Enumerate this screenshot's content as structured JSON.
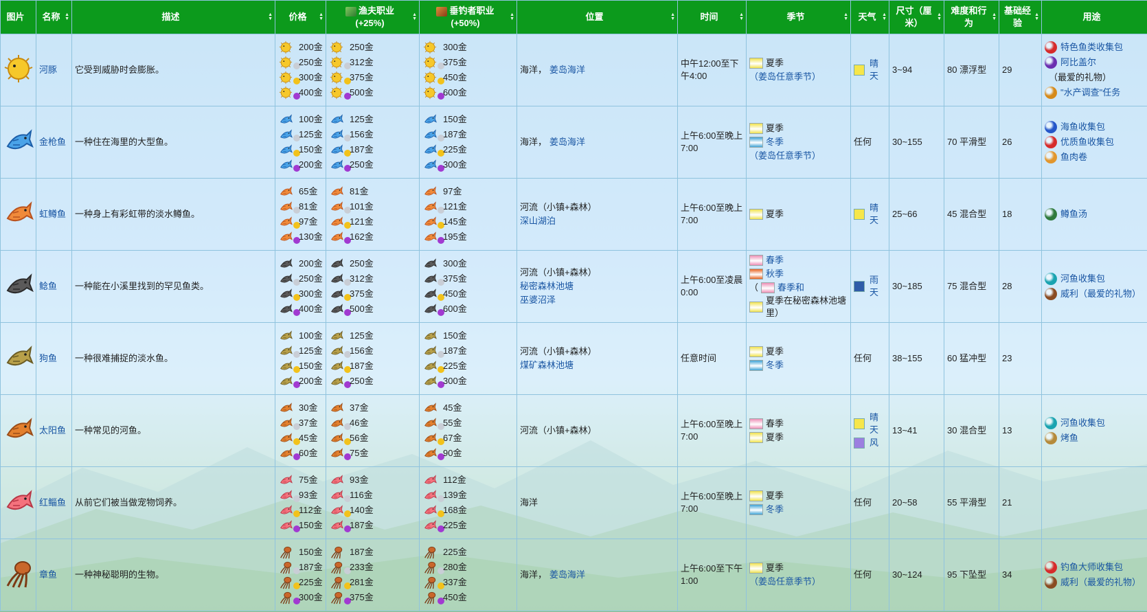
{
  "headers": {
    "image": "图片",
    "name": "名称",
    "desc": "描述",
    "price": "价格",
    "fisher": "渔夫职业",
    "fisher_pct": "(+25%)",
    "angler": "垂钓者职业",
    "angler_pct": "(+50%)",
    "location": "位置",
    "time": "时间",
    "season": "季节",
    "weather": "天气",
    "size": "尺寸（厘米）",
    "difficulty": "难度和行为",
    "xp": "基础经验",
    "uses": "用途"
  },
  "colors": {
    "header_bg": "#0c9a1c",
    "link": "#1a56a3",
    "border": "#8fc3de"
  },
  "rows": [
    {
      "name": "河豚",
      "icon": "pufferfish-icon",
      "desc": "它受到威胁时会膨胀。",
      "price": [
        "200金",
        "250金",
        "300金",
        "400金"
      ],
      "fisher": [
        "250金",
        "312金",
        "375金",
        "500金"
      ],
      "angler": [
        "300金",
        "375金",
        "450金",
        "600金"
      ],
      "location": [
        {
          "t": "海洋，",
          "l": false
        },
        {
          "t": "姜岛海洋",
          "l": true
        }
      ],
      "time": "中午12:00至下午4:00",
      "seasons": [
        {
          "t": "夏季",
          "ico": "summer-icon"
        },
        {
          "t": "（姜岛任意季节）",
          "ico": "",
          "l": true
        }
      ],
      "weather": [
        {
          "t": "晴天",
          "ico": "sun-icon",
          "l": true
        }
      ],
      "size": "3~94",
      "difficulty": "80 漂浮型",
      "xp": "29",
      "uses": [
        {
          "t": "特色鱼类收集包",
          "ico": "bundle-red-icon",
          "c": "#d62b2b",
          "l": true
        },
        {
          "t": "阿比盖尔",
          "ico": "abigail-icon",
          "c": "#6b2fb0",
          "l": true
        },
        {
          "t": "（最爱的礼物）",
          "ico": "",
          "l": false
        },
        {
          "t": "\"水产调查\"任务",
          "ico": "quest-icon",
          "c": "#d68a1a",
          "l": true
        }
      ]
    },
    {
      "name": "金枪鱼",
      "icon": "tuna-icon",
      "desc": "一种住在海里的大型鱼。",
      "price": [
        "100金",
        "125金",
        "150金",
        "200金"
      ],
      "fisher": [
        "125金",
        "156金",
        "187金",
        "250金"
      ],
      "angler": [
        "150金",
        "187金",
        "225金",
        "300金"
      ],
      "location": [
        {
          "t": "海洋，",
          "l": false
        },
        {
          "t": "姜岛海洋",
          "l": true
        }
      ],
      "time": "上午6:00至晚上7:00",
      "seasons": [
        {
          "t": "夏季",
          "ico": "summer-icon"
        },
        {
          "t": "冬季",
          "ico": "winter-icon",
          "l": true
        },
        {
          "t": "（姜岛任意季节）",
          "ico": "",
          "l": true
        }
      ],
      "weather": [
        {
          "t": "任何",
          "ico": "",
          "l": false
        }
      ],
      "size": "30~155",
      "difficulty": "70 平滑型",
      "xp": "26",
      "uses": [
        {
          "t": "海鱼收集包",
          "ico": "bundle-blue-icon",
          "c": "#2456c9",
          "l": true
        },
        {
          "t": "优质鱼收集包",
          "ico": "bundle-red-icon",
          "c": "#d62b2b",
          "l": true
        },
        {
          "t": "鱼肉卷",
          "ico": "maki-icon",
          "c": "#e2962d",
          "l": true
        }
      ]
    },
    {
      "name": "虹鳟鱼",
      "icon": "rainbow-trout-icon",
      "desc": "一种身上有彩虹带的淡水鳟鱼。",
      "price": [
        "65金",
        "81金",
        "97金",
        "130金"
      ],
      "fisher": [
        "81金",
        "101金",
        "121金",
        "162金"
      ],
      "angler": [
        "97金",
        "121金",
        "145金",
        "195金"
      ],
      "location": [
        {
          "t": "河流（小镇+森林）",
          "l": false
        },
        {
          "t": "深山湖泊",
          "l": true
        }
      ],
      "time": "上午6:00至晚上7:00",
      "seasons": [
        {
          "t": "夏季",
          "ico": "summer-icon"
        }
      ],
      "weather": [
        {
          "t": "晴天",
          "ico": "sun-icon",
          "l": true
        }
      ],
      "size": "25~66",
      "difficulty": "45 混合型",
      "xp": "18",
      "uses": [
        {
          "t": "鳟鱼汤",
          "ico": "trout-soup-icon",
          "c": "#2f7a3c",
          "l": true
        }
      ]
    },
    {
      "name": "鲶鱼",
      "icon": "catfish-icon",
      "desc": "一种能在小溪里找到的罕见鱼类。",
      "price": [
        "200金",
        "250金",
        "300金",
        "400金"
      ],
      "fisher": [
        "250金",
        "312金",
        "375金",
        "500金"
      ],
      "angler": [
        "300金",
        "375金",
        "450金",
        "600金"
      ],
      "location": [
        {
          "t": "河流（小镇+森林）",
          "l": false
        },
        {
          "t": "秘密森林池塘",
          "l": true
        },
        {
          "t": "巫婆沼泽",
          "l": true
        }
      ],
      "time": "上午6:00至凌晨0:00",
      "seasons": [
        {
          "t": "春季",
          "ico": "spring-icon",
          "l": true
        },
        {
          "t": "秋季",
          "ico": "fall-icon",
          "l": true
        },
        {
          "t": "春季和",
          "ico": "spring-icon",
          "l": true,
          "paren": true
        },
        {
          "t": "夏季在秘密森林池塘里）",
          "ico": "summer-icon",
          "l": false
        }
      ],
      "weather": [
        {
          "t": "雨天",
          "ico": "rain-icon",
          "l": true
        }
      ],
      "size": "30~185",
      "difficulty": "75 混合型",
      "xp": "28",
      "uses": [
        {
          "t": "河鱼收集包",
          "ico": "bundle-teal-icon",
          "c": "#1aa3b0",
          "l": true
        },
        {
          "t": "威利（最爱的礼物）",
          "ico": "willy-icon",
          "c": "#8a4b22",
          "l": true
        }
      ]
    },
    {
      "name": "狗鱼",
      "icon": "pike-icon",
      "desc": "一种很难捕捉的淡水鱼。",
      "price": [
        "100金",
        "125金",
        "150金",
        "200金"
      ],
      "fisher": [
        "125金",
        "156金",
        "187金",
        "250金"
      ],
      "angler": [
        "150金",
        "187金",
        "225金",
        "300金"
      ],
      "location": [
        {
          "t": "河流（小镇+森林）",
          "l": false
        },
        {
          "t": "煤矿森林池塘",
          "l": true
        }
      ],
      "time": "任意时间",
      "seasons": [
        {
          "t": "夏季",
          "ico": "summer-icon"
        },
        {
          "t": "冬季",
          "ico": "winter-icon",
          "l": true
        }
      ],
      "weather": [
        {
          "t": "任何",
          "ico": "",
          "l": false
        }
      ],
      "size": "38~155",
      "difficulty": "60 猛冲型",
      "xp": "23",
      "uses": []
    },
    {
      "name": "太阳鱼",
      "icon": "sunfish-icon",
      "desc": "一种常见的河鱼。",
      "price": [
        "30金",
        "37金",
        "45金",
        "60金"
      ],
      "fisher": [
        "37金",
        "46金",
        "56金",
        "75金"
      ],
      "angler": [
        "45金",
        "55金",
        "67金",
        "90金"
      ],
      "location": [
        {
          "t": "河流（小镇+森林）",
          "l": false
        }
      ],
      "time": "上午6:00至晚上7:00",
      "seasons": [
        {
          "t": "春季",
          "ico": "spring-icon"
        },
        {
          "t": "夏季",
          "ico": "summer-icon"
        }
      ],
      "weather": [
        {
          "t": "晴天",
          "ico": "sun-icon",
          "l": true
        },
        {
          "t": "风",
          "ico": "wind-icon",
          "l": true
        }
      ],
      "size": "13~41",
      "difficulty": "30 混合型",
      "xp": "13",
      "uses": [
        {
          "t": "河鱼收集包",
          "ico": "bundle-teal-icon",
          "c": "#1aa3b0",
          "l": true
        },
        {
          "t": "烤鱼",
          "ico": "baked-fish-icon",
          "c": "#b58a3a",
          "l": true
        }
      ]
    },
    {
      "name": "红鲻鱼",
      "icon": "red-mullet-icon",
      "desc": "从前它们被当做宠物饲养。",
      "price": [
        "75金",
        "93金",
        "112金",
        "150金"
      ],
      "fisher": [
        "93金",
        "116金",
        "140金",
        "187金"
      ],
      "angler": [
        "112金",
        "139金",
        "168金",
        "225金"
      ],
      "location": [
        {
          "t": "海洋",
          "l": false
        }
      ],
      "time": "上午6:00至晚上7:00",
      "seasons": [
        {
          "t": "夏季",
          "ico": "summer-icon"
        },
        {
          "t": "冬季",
          "ico": "winter-icon",
          "l": true
        }
      ],
      "weather": [
        {
          "t": "任何",
          "ico": "",
          "l": false
        }
      ],
      "size": "20~58",
      "difficulty": "55 平滑型",
      "xp": "21",
      "uses": []
    },
    {
      "name": "章鱼",
      "icon": "octopus-icon",
      "desc": "一种神秘聪明的生物。",
      "price": [
        "150金",
        "187金",
        "225金",
        "300金"
      ],
      "fisher": [
        "187金",
        "233金",
        "281金",
        "375金"
      ],
      "angler": [
        "225金",
        "280金",
        "337金",
        "450金"
      ],
      "location": [
        {
          "t": "海洋，",
          "l": false
        },
        {
          "t": "姜岛海洋",
          "l": true
        }
      ],
      "time": "上午6:00至下午1:00",
      "seasons": [
        {
          "t": "夏季",
          "ico": "summer-icon"
        },
        {
          "t": "（姜岛任意季节）",
          "ico": "",
          "l": true
        }
      ],
      "weather": [
        {
          "t": "任何",
          "ico": "",
          "l": false
        }
      ],
      "size": "30~124",
      "difficulty": "95 下坠型",
      "xp": "34",
      "uses": [
        {
          "t": "钓鱼大师收集包",
          "ico": "bundle-red-icon",
          "c": "#d62b2b",
          "l": true
        },
        {
          "t": "威利（最爱的礼物）",
          "ico": "willy-icon",
          "c": "#8a4b22",
          "l": true
        }
      ]
    }
  ]
}
